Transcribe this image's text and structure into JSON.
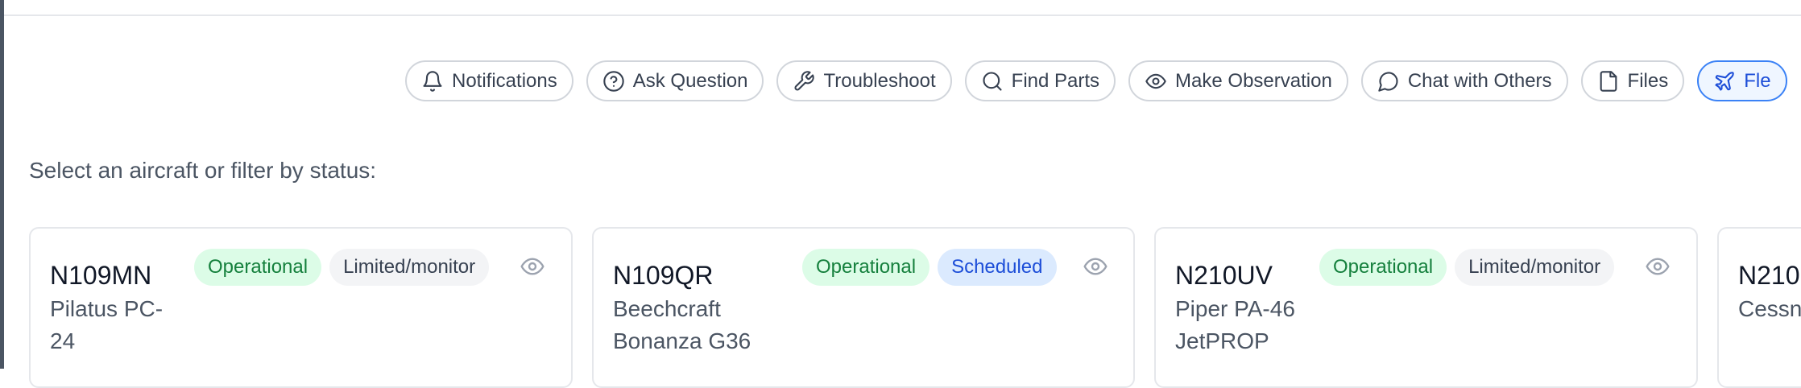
{
  "actions": [
    {
      "label": "Notifications",
      "icon": "bell-icon"
    },
    {
      "label": "Ask Question",
      "icon": "question-circle-icon"
    },
    {
      "label": "Troubleshoot",
      "icon": "wrench-icon"
    },
    {
      "label": "Find Parts",
      "icon": "search-icon"
    },
    {
      "label": "Make Observation",
      "icon": "eye-icon"
    },
    {
      "label": "Chat with Others",
      "icon": "chat-bubble-icon"
    },
    {
      "label": "Files",
      "icon": "file-icon"
    },
    {
      "label": "Fle",
      "icon": "plane-icon",
      "active": true
    }
  ],
  "prompt": "Select an aircraft or filter by status:",
  "aircraft": [
    {
      "tail": "N109MN",
      "model_lines": [
        "Pilatus PC-",
        "24"
      ],
      "badges": [
        "Operational",
        "Limited/monitor"
      ]
    },
    {
      "tail": "N109QR",
      "model_lines": [
        "Beechcraft",
        "Bonanza G36"
      ],
      "badges": [
        "Operational",
        "Scheduled"
      ]
    },
    {
      "tail": "N210UV",
      "model_lines": [
        "Piper PA-46",
        "JetPROP"
      ],
      "badges": [
        "Operational",
        "Limited/monitor"
      ]
    },
    {
      "tail": "N210",
      "model_lines": [
        "Cessn"
      ],
      "badges": []
    }
  ],
  "colors": {
    "operational_bg": "#dcfce7",
    "operational_text": "#15803d",
    "limited_bg": "#f3f4f6",
    "scheduled_bg": "#dbeafe",
    "scheduled_text": "#1d4ed8",
    "active_border": "#3b82f6"
  }
}
